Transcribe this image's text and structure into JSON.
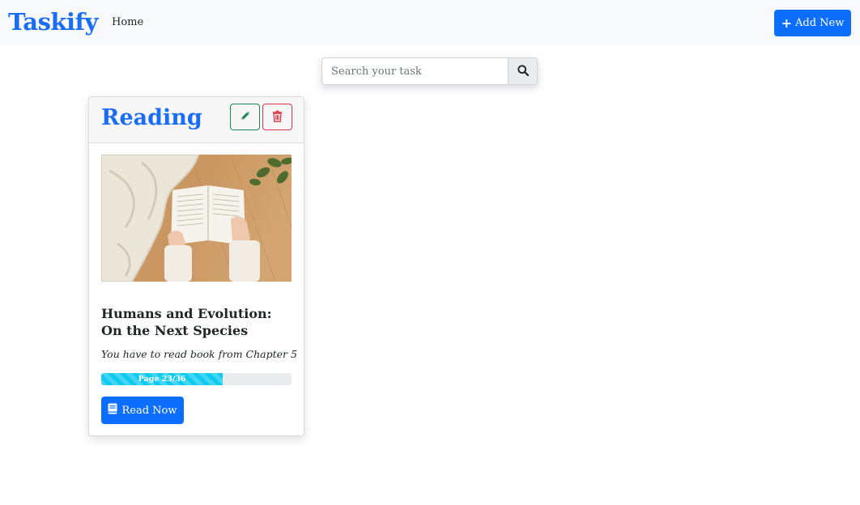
{
  "navbar": {
    "brand": "Taskify",
    "home_label": "Home",
    "add_new_label": "Add New",
    "add_icon": "plus-icon"
  },
  "search": {
    "placeholder": "Search your task",
    "value": "",
    "icon": "search-icon"
  },
  "task_card": {
    "category": "Reading",
    "edit_icon": "pencil-icon",
    "delete_icon": "trash-icon",
    "image": "open-book-photo",
    "title": "Humans and Evolution: On the Next Species",
    "description": "You have to read book from Chapter 5",
    "progress": {
      "label": "Page 23/36",
      "current_page": 23,
      "total_pages": 36,
      "fraction": 0.639,
      "color": "#0dcaf0"
    },
    "read_now_label": "Read Now",
    "read_icon": "book-icon"
  },
  "colors": {
    "brand": "#1a6ef5",
    "primary": "#0d6efd",
    "success": "#198754",
    "danger": "#dc3545",
    "navbar_bg": "#f8f9fa"
  }
}
